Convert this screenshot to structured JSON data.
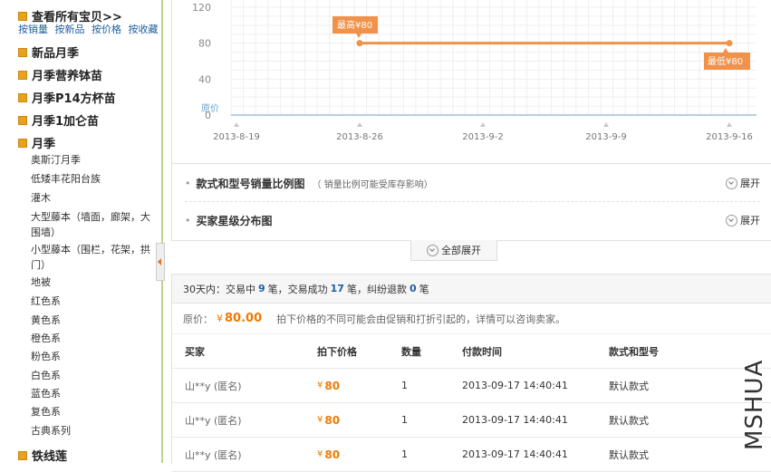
{
  "sidebar": {
    "all_items_title": "查看所有宝贝>>",
    "sort_links": [
      "按销量",
      "按新品",
      "按价格",
      "按收藏"
    ],
    "categories_top": [
      "新品月季",
      "月季营养钵苗",
      "月季P14方杯苗",
      "月季1加仑苗",
      "月季"
    ],
    "subcategories": [
      "奥斯汀月季",
      "低矮丰花阳台族",
      "灌木",
      "大型藤本（墙面，廊架，大围墙）",
      "小型藤本（围栏，花架，拱门）",
      "地被",
      "红色系",
      "黄色系",
      "橙色系",
      "粉色系",
      "白色系",
      "蓝色系",
      "复色系",
      "古典系列"
    ],
    "category_bottom": "铁线莲"
  },
  "price_chart": {
    "y_ticks": [
      "120",
      "80",
      "40",
      "0"
    ],
    "original_price_label": "原价",
    "high_label": "最高¥80",
    "low_label": "最低¥80",
    "x_ticks": [
      "2013-8-19",
      "2013-8-26",
      "2013-9-2",
      "2013-9-9",
      "2013-9-16"
    ],
    "line_color": "#f0924a"
  },
  "chart_data": {
    "type": "line",
    "x": [
      "2013-8-26",
      "2013-9-16"
    ],
    "series": [
      {
        "values": [
          80,
          80
        ]
      }
    ],
    "ylim": [
      0,
      120
    ],
    "y_ticks": [
      0,
      40,
      80,
      120
    ],
    "x_ticks": [
      "2013-8-19",
      "2013-8-26",
      "2013-9-2",
      "2013-9-9",
      "2013-9-16"
    ],
    "annotations": [
      "最高¥80",
      "最低¥80",
      "原价"
    ],
    "grid": true
  },
  "sections": [
    {
      "title": "款式和型号销量比例图",
      "note": "（ 销量比例可能受库存影响）",
      "expand": "展开"
    },
    {
      "title": "买家星级分布图",
      "note": "",
      "expand": "展开"
    }
  ],
  "expand_all": "全部展开",
  "transactions": {
    "summary": {
      "prefix": "30天内：交易中",
      "in_progress": "9",
      "mid1": "笔，交易成功",
      "success": "17",
      "mid2": "笔，纠纷退款",
      "dispute": "0",
      "suffix": "笔"
    },
    "original_price_label": "原价：",
    "original_price_currency": "¥",
    "original_price_value": "80.00",
    "price_note": "拍下价格的不同可能会由促销和打折引起的，详情可以咨询卖家。",
    "columns": [
      "买家",
      "拍下价格",
      "数量",
      "付款时间",
      "款式和型号"
    ],
    "rows": [
      {
        "buyer": "山**y (匿名)",
        "currency": "¥",
        "price": "80",
        "qty": "1",
        "time": "2013-09-17 14:40:41",
        "style": "默认款式"
      },
      {
        "buyer": "山**y (匿名)",
        "currency": "¥",
        "price": "80",
        "qty": "1",
        "time": "2013-09-17 14:40:41",
        "style": "默认款式"
      },
      {
        "buyer": "山**y (匿名)",
        "currency": "¥",
        "price": "80",
        "qty": "1",
        "time": "2013-09-17 14:40:41",
        "style": "默认款式"
      }
    ]
  },
  "watermark": "MSHUA"
}
